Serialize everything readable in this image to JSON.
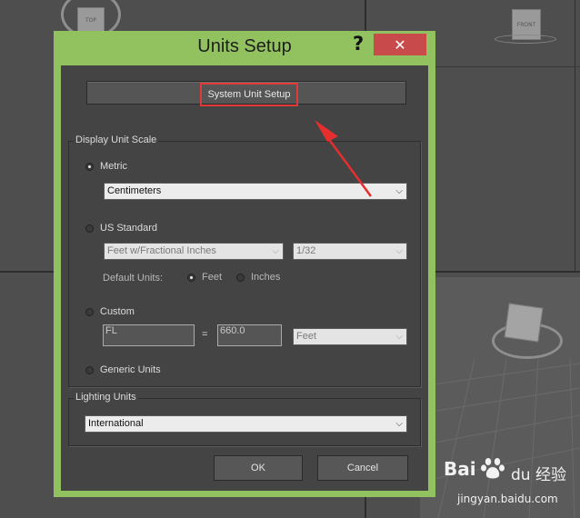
{
  "dialog": {
    "title": "Units Setup",
    "help_label": "?",
    "close_label": "✕"
  },
  "system_unit_setup": {
    "label": "System Unit Setup"
  },
  "display_unit_scale": {
    "group_label": "Display Unit Scale",
    "metric": {
      "label": "Metric",
      "selected": true,
      "dropdown_value": "Centimeters"
    },
    "us_standard": {
      "label": "US Standard",
      "selected": false,
      "unit_value": "Feet w/Fractional Inches",
      "fraction_value": "1/32",
      "default_units_label": "Default Units:",
      "feet_label": "Feet",
      "inches_label": "Inches",
      "feet_selected": true
    },
    "custom": {
      "label": "Custom",
      "selected": false,
      "name_value": "FL",
      "equals": "=",
      "amount_value": "660.0",
      "unit_value": "Feet"
    },
    "generic": {
      "label": "Generic Units",
      "selected": false
    }
  },
  "lighting_units": {
    "group_label": "Lighting Units",
    "dropdown_value": "International"
  },
  "buttons": {
    "ok_label": "OK",
    "cancel_label": "Cancel"
  },
  "viewports": {
    "top_label": "TOP",
    "front_label": "FRONT"
  },
  "watermark": {
    "brand_latin_1": "Bai",
    "brand_latin_2": "du",
    "brand_cn": "经验",
    "url": "jingyan.baidu.com"
  },
  "colors": {
    "dialog_frame": "#92c25f",
    "dialog_body": "#444444",
    "highlight_red": "#e03a3a",
    "close_button": "#c94a4a"
  },
  "icons": {
    "dropdown": "chevron-down-icon",
    "annotation": "red-arrow-icon",
    "nav_cube": "view-cube-icon"
  }
}
